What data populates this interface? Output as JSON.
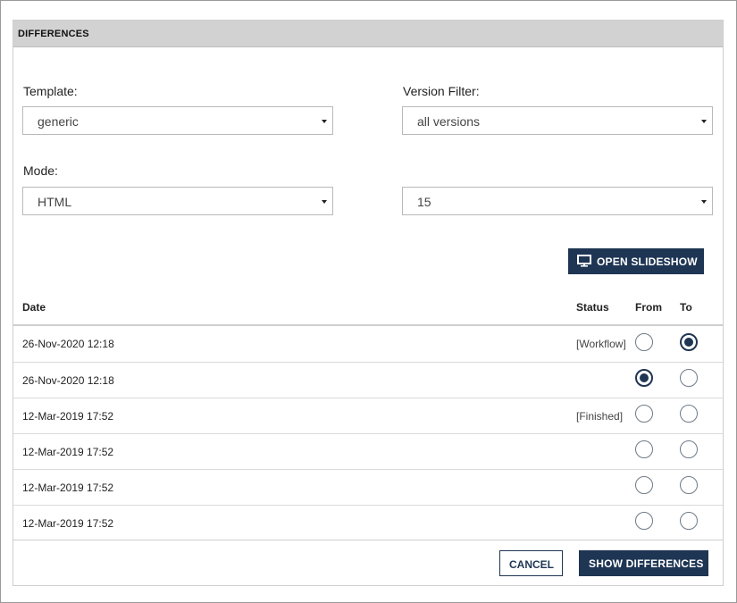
{
  "dialog": {
    "title": "DIFFERENCES"
  },
  "form": {
    "template_label": "Template:",
    "template_value": "generic",
    "version_filter_label": "Version Filter:",
    "version_filter_value": "all versions",
    "mode_label": "Mode:",
    "mode_value": "HTML",
    "count_value": "15"
  },
  "slideshow_button": {
    "label": "OPEN SLIDESHOW",
    "icon": "monitor-icon"
  },
  "table": {
    "headers": {
      "date": "Date",
      "status": "Status",
      "from": "From",
      "to": "To"
    },
    "rows": [
      {
        "date": "26-Nov-2020 12:18",
        "status": "[Workflow]",
        "from_checked": false,
        "to_checked": true
      },
      {
        "date": "26-Nov-2020 12:18",
        "status": "",
        "from_checked": true,
        "to_checked": false
      },
      {
        "date": "12-Mar-2019 17:52",
        "status": "[Finished]",
        "from_checked": false,
        "to_checked": false
      },
      {
        "date": "12-Mar-2019 17:52",
        "status": "",
        "from_checked": false,
        "to_checked": false
      },
      {
        "date": "12-Mar-2019 17:52",
        "status": "",
        "from_checked": false,
        "to_checked": false
      },
      {
        "date": "12-Mar-2019 17:52",
        "status": "",
        "from_checked": false,
        "to_checked": false
      }
    ]
  },
  "footer": {
    "cancel_label": "CANCEL",
    "show_differences_label": "SHOW DIFFERENCES"
  },
  "colors": {
    "primary": "#1e3553",
    "header_bg": "#d2d2d2"
  }
}
